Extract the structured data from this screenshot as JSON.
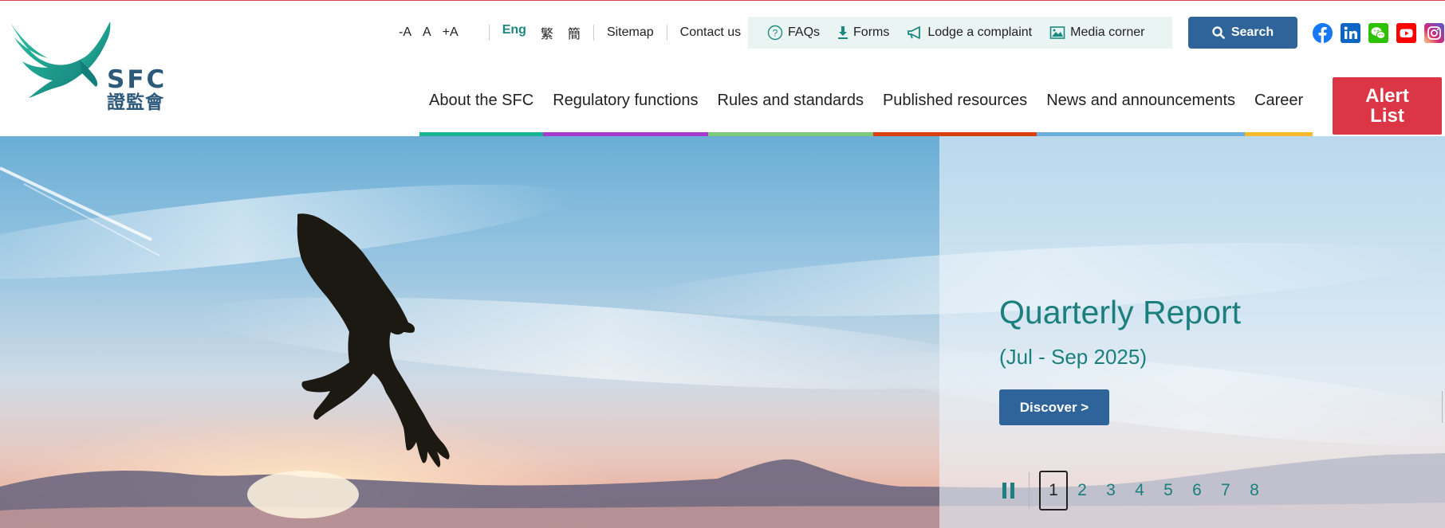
{
  "logo": {
    "en": "SFC",
    "zh": "證監會"
  },
  "utility": {
    "font_sizes": [
      "-A",
      "A",
      "+A"
    ],
    "languages": [
      {
        "label": "Eng",
        "active": true
      },
      {
        "label": "繁",
        "active": false
      },
      {
        "label": "簡",
        "active": false
      }
    ],
    "sitemap": "Sitemap",
    "contact": "Contact us",
    "quick_links": [
      {
        "label": "FAQs",
        "icon": "question-circle-icon"
      },
      {
        "label": "Forms",
        "icon": "download-icon"
      },
      {
        "label": "Lodge a complaint",
        "icon": "megaphone-icon"
      },
      {
        "label": "Media corner",
        "icon": "image-icon"
      }
    ],
    "search_label": "Search"
  },
  "socials": [
    {
      "name": "facebook",
      "color": "#1877f2"
    },
    {
      "name": "linkedin",
      "color": "#0a66c2"
    },
    {
      "name": "wechat",
      "color": "#2dc100"
    },
    {
      "name": "youtube",
      "color": "#ff0000"
    },
    {
      "name": "instagram",
      "color": "#c13584"
    }
  ],
  "nav": [
    {
      "label": "About the SFC",
      "color": "#1ab394"
    },
    {
      "label": "Regulatory functions",
      "color": "#a63ccd"
    },
    {
      "label": "Rules and standards",
      "color": "#7ec87b"
    },
    {
      "label": "Published resources",
      "color": "#d9400f"
    },
    {
      "label": "News and announcements",
      "color": "#6aaedc"
    },
    {
      "label": "Career",
      "color": "#f5b82e"
    }
  ],
  "alert": {
    "line1": "Alert",
    "line2": "List"
  },
  "hero": {
    "title": "Quarterly Report",
    "subtitle": "(Jul - Sep 2025)",
    "cta": "Discover >",
    "pages": [
      "1",
      "2",
      "3",
      "4",
      "5",
      "6",
      "7",
      "8"
    ],
    "active_page": "1"
  },
  "colors": {
    "brand_teal": "#1a7f7d",
    "brand_blue": "#2e6499",
    "alert_red": "#dc3545"
  }
}
